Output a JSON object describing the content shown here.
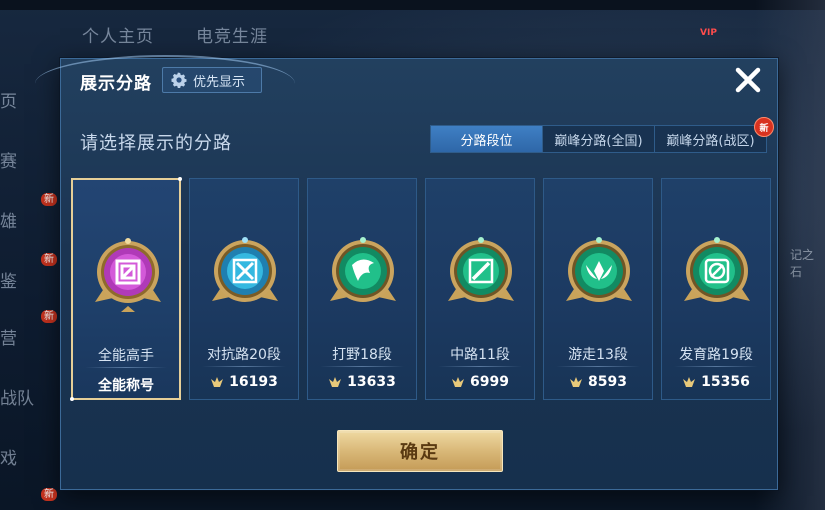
{
  "background": {
    "tabs": [
      "个人主页",
      "电竞生涯"
    ],
    "side_items": [
      "页",
      "赛",
      "雄",
      "鉴",
      "营",
      "战队",
      "戏"
    ],
    "new_badge": "新",
    "vip": "VIP",
    "right_text": "记之石"
  },
  "dialog": {
    "title": "展示分路",
    "priority_label": "优先显示",
    "subtitle": "请选择展示的分路",
    "tabs": [
      {
        "label": "分路段位",
        "active": true
      },
      {
        "label": "巅峰分路(全国)",
        "active": false
      },
      {
        "label": "巅峰分路(战区)",
        "active": false,
        "badge": "新"
      }
    ],
    "confirm_label": "确定"
  },
  "lanes": [
    {
      "name": "全能高手",
      "value": "全能称号",
      "icon": "all-round-badge-icon",
      "selected": true
    },
    {
      "name": "对抗路20段",
      "value": "16193",
      "icon": "clash-lane-badge-icon",
      "selected": false
    },
    {
      "name": "打野18段",
      "value": "13633",
      "icon": "jungle-badge-icon",
      "selected": false
    },
    {
      "name": "中路11段",
      "value": "6999",
      "icon": "mid-lane-badge-icon",
      "selected": false
    },
    {
      "name": "游走13段",
      "value": "8593",
      "icon": "roam-badge-icon",
      "selected": false
    },
    {
      "name": "发育路19段",
      "value": "15356",
      "icon": "farm-lane-badge-icon",
      "selected": false
    }
  ],
  "colors": {
    "selected_border": "#e6cf98",
    "purple_badge": "#b03ab8",
    "blue_badge": "#35b8e0",
    "green_badge": "#21c08a",
    "gold_frame": "#d8b46a",
    "confirm_gold": "#d9b878"
  }
}
